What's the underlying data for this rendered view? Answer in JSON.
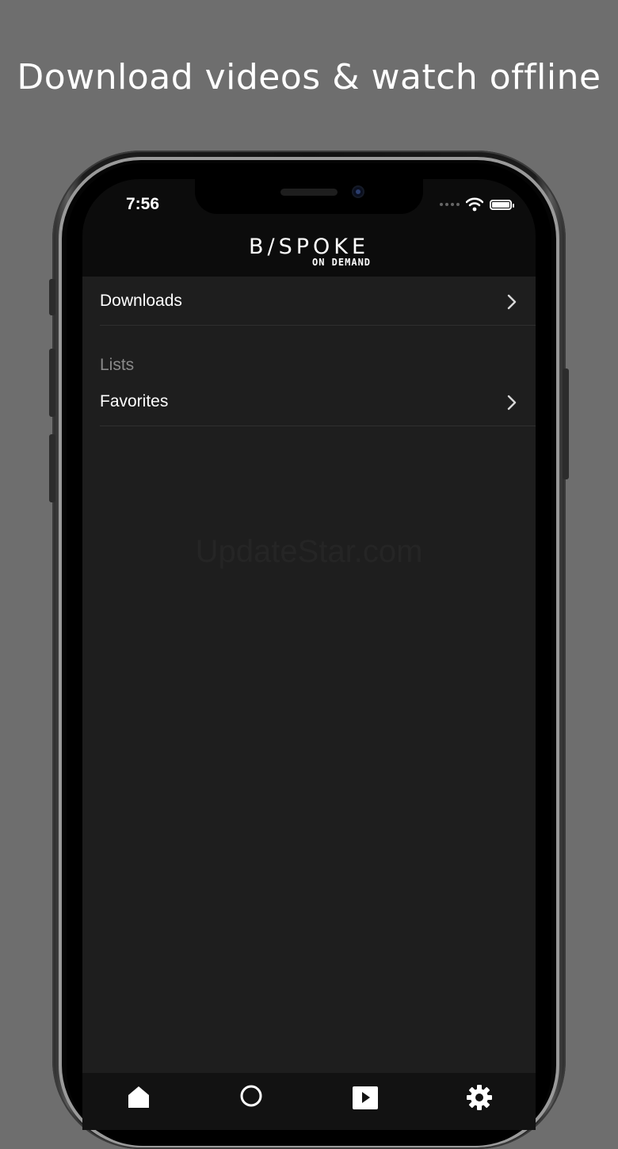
{
  "headline": "Download videos & watch offline",
  "status_bar": {
    "time": "7:56",
    "icons": [
      "signal-icon",
      "wifi-icon",
      "battery-icon"
    ]
  },
  "app": {
    "logo_main": "B/SPOKE",
    "logo_sub": "ON DEMAND"
  },
  "menu": {
    "downloads_label": "Downloads",
    "section_label": "Lists",
    "favorites_label": "Favorites"
  },
  "watermark": "UpdateStar.com",
  "tabs": [
    "home-icon",
    "search-icon",
    "play-icon",
    "gear-icon"
  ],
  "colors": {
    "page_bg": "#6e6e6e",
    "screen_bg": "#1e1e1e",
    "text": "#ffffff",
    "muted": "#8a8a8a"
  }
}
